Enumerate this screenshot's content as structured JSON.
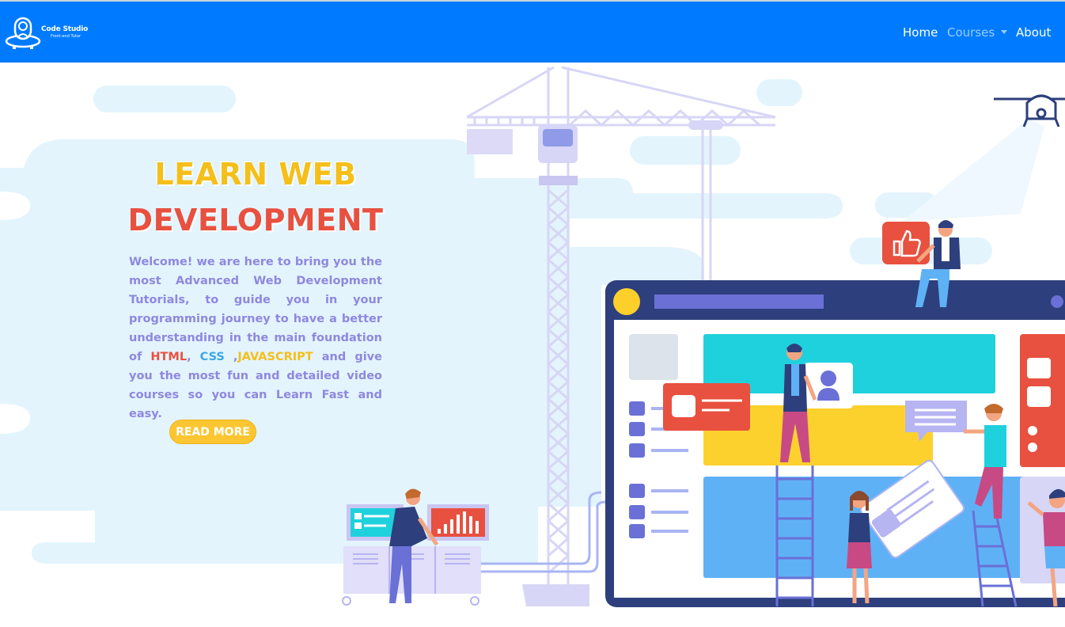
{
  "brand": {
    "name": "Code Studio",
    "tagline": "Front-end Tutor"
  },
  "nav": {
    "home": "Home",
    "courses": "Courses",
    "about": "About"
  },
  "hero": {
    "title_line1": "LEARN WEB",
    "title_line2": "DEVELOPMENT",
    "description_intro": "Welcome! we are here to bring you the most Advanced Web Development Tutorials, to guide you in your programming journey to have a better understanding in the main foundation of",
    "kw_html": "HTML",
    "sep1": ",",
    "kw_css": "CSS",
    "sep2": ",",
    "kw_js": "JAVASCRIPT",
    "description_outro": "and give you the most fun and detailed video courses so you can Learn Fast and easy.",
    "button_label": "READ MORE"
  },
  "colors": {
    "navbar": "#007bff",
    "title_yellow": "#f4bf1a",
    "title_red": "#e8503f",
    "description": "#8e88df",
    "css_blue": "#3aa5e6",
    "button": "#fbc632"
  },
  "illustration": {
    "thumbs_up_icon": "thumbs-up-icon",
    "user_icon": "user-icon",
    "drone_icon": "drone-icon"
  }
}
